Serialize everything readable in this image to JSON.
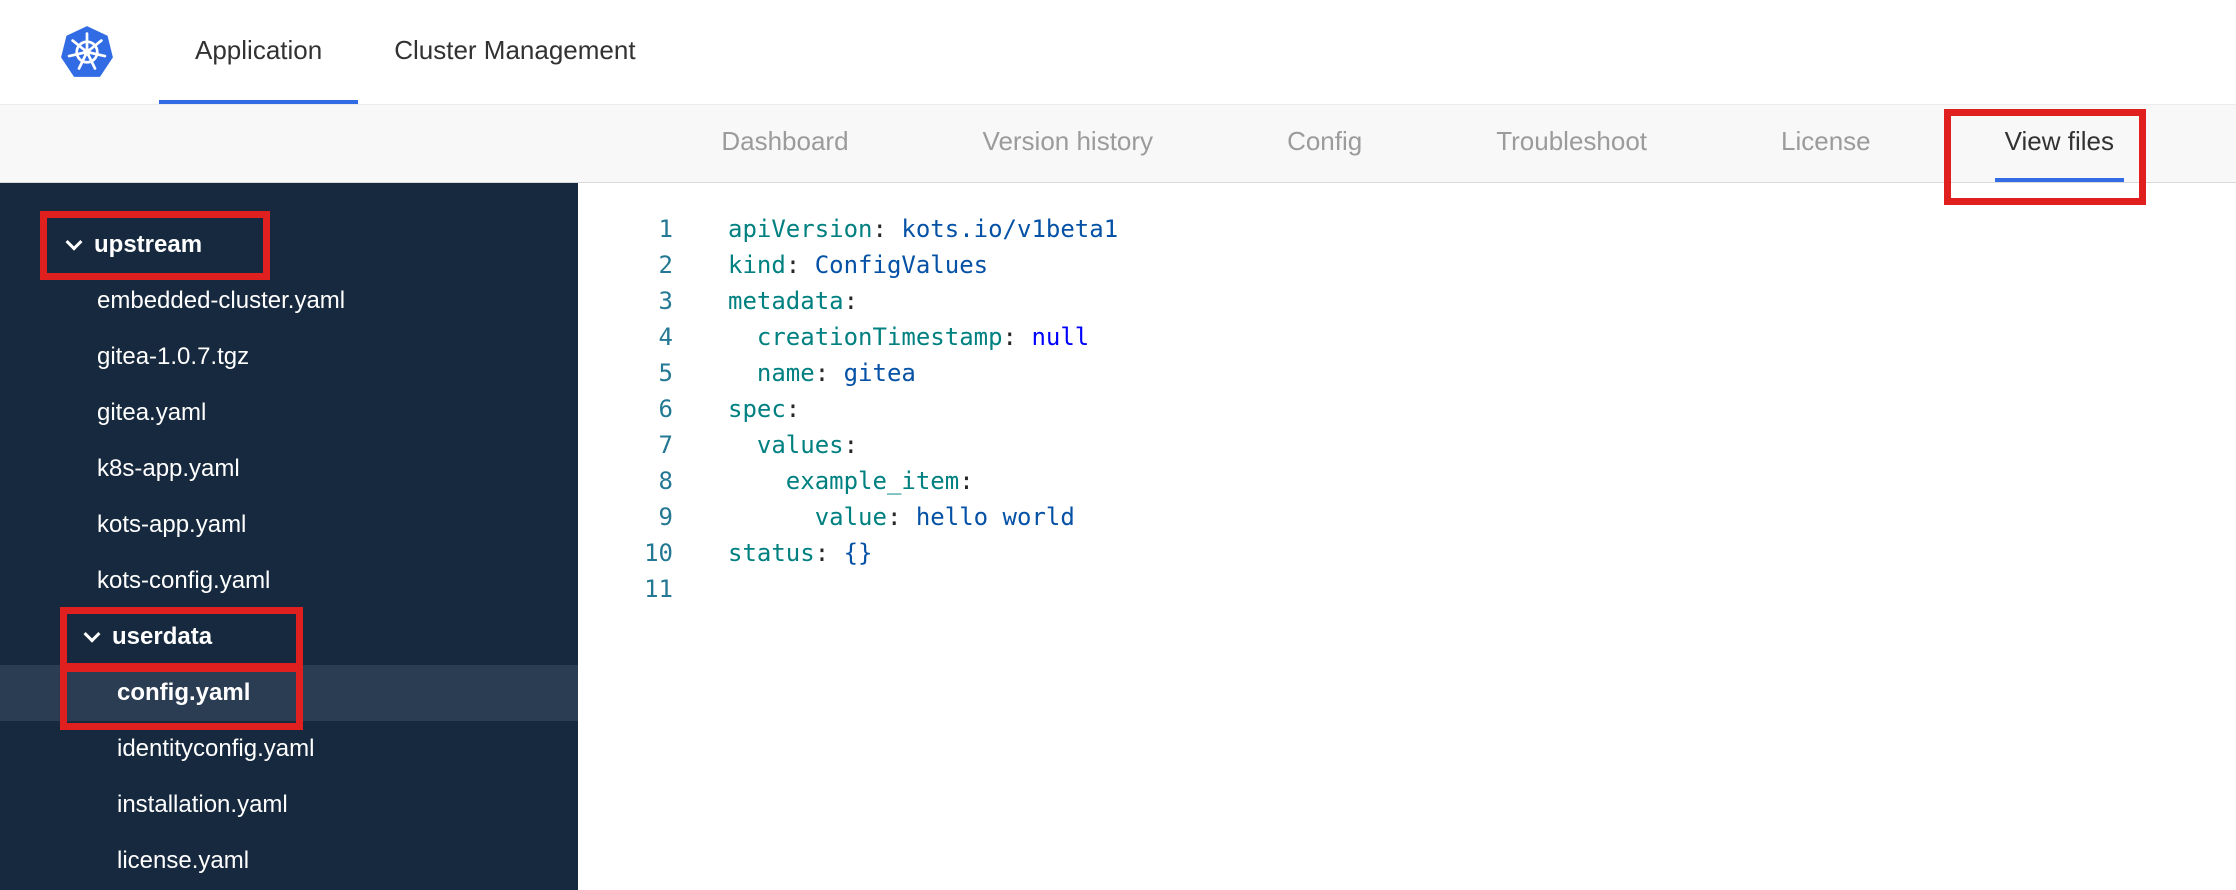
{
  "header": {
    "app_tabs": [
      {
        "label": "Application",
        "active": true
      },
      {
        "label": "Cluster Management",
        "active": false
      }
    ]
  },
  "logo": {
    "icon": "kubernetes-helm-wheel-icon"
  },
  "subnav": {
    "items": [
      {
        "label": "Dashboard",
        "active": false
      },
      {
        "label": "Version history",
        "active": false
      },
      {
        "label": "Config",
        "active": false
      },
      {
        "label": "Troubleshoot",
        "active": false
      },
      {
        "label": "License",
        "active": false
      },
      {
        "label": "View files",
        "active": true,
        "annotated": true
      }
    ]
  },
  "sidebar": {
    "items": [
      {
        "type": "folder",
        "label": "upstream",
        "depth": 0,
        "expanded": true,
        "annotated": true
      },
      {
        "type": "file",
        "label": "embedded-cluster.yaml",
        "depth": 1
      },
      {
        "type": "file",
        "label": "gitea-1.0.7.tgz",
        "depth": 1
      },
      {
        "type": "file",
        "label": "gitea.yaml",
        "depth": 1
      },
      {
        "type": "file",
        "label": "k8s-app.yaml",
        "depth": 1
      },
      {
        "type": "file",
        "label": "kots-app.yaml",
        "depth": 1
      },
      {
        "type": "file",
        "label": "kots-config.yaml",
        "depth": 1
      },
      {
        "type": "folder",
        "label": "userdata",
        "depth": 1,
        "expanded": true,
        "annotated": true
      },
      {
        "type": "file",
        "label": "config.yaml",
        "depth": 2,
        "selected": true,
        "annotated": true
      },
      {
        "type": "file",
        "label": "identityconfig.yaml",
        "depth": 2
      },
      {
        "type": "file",
        "label": "installation.yaml",
        "depth": 2
      },
      {
        "type": "file",
        "label": "license.yaml",
        "depth": 2
      }
    ]
  },
  "editor": {
    "language": "yaml",
    "lines": [
      [
        {
          "c": "key",
          "t": "apiVersion"
        },
        {
          "c": "plain",
          "t": ": "
        },
        {
          "c": "val",
          "t": "kots.io/v1beta1"
        }
      ],
      [
        {
          "c": "key",
          "t": "kind"
        },
        {
          "c": "plain",
          "t": ": "
        },
        {
          "c": "val",
          "t": "ConfigValues"
        }
      ],
      [
        {
          "c": "key",
          "t": "metadata"
        },
        {
          "c": "plain",
          "t": ":"
        }
      ],
      [
        {
          "c": "plain",
          "t": "  "
        },
        {
          "c": "key",
          "t": "creationTimestamp"
        },
        {
          "c": "plain",
          "t": ": "
        },
        {
          "c": "kw",
          "t": "null"
        }
      ],
      [
        {
          "c": "plain",
          "t": "  "
        },
        {
          "c": "key",
          "t": "name"
        },
        {
          "c": "plain",
          "t": ": "
        },
        {
          "c": "val",
          "t": "gitea"
        }
      ],
      [
        {
          "c": "key",
          "t": "spec"
        },
        {
          "c": "plain",
          "t": ":"
        }
      ],
      [
        {
          "c": "plain",
          "t": "  "
        },
        {
          "c": "key",
          "t": "values"
        },
        {
          "c": "plain",
          "t": ":"
        }
      ],
      [
        {
          "c": "plain",
          "t": "    "
        },
        {
          "c": "key",
          "t": "example_item"
        },
        {
          "c": "plain",
          "t": ":"
        }
      ],
      [
        {
          "c": "plain",
          "t": "      "
        },
        {
          "c": "key",
          "t": "value"
        },
        {
          "c": "plain",
          "t": ": "
        },
        {
          "c": "val",
          "t": "hello world"
        }
      ],
      [
        {
          "c": "key",
          "t": "status"
        },
        {
          "c": "plain",
          "t": ": "
        },
        {
          "c": "punct",
          "t": "{}"
        }
      ],
      []
    ]
  },
  "annotations": {
    "highlighted_elements": [
      "view-files-tab",
      "upstream-folder",
      "userdata-folder",
      "config-yaml-file"
    ]
  },
  "colors": {
    "accent_blue": "#326de6",
    "annotation_red": "#e01f1f",
    "sidebar_bg": "#17293e",
    "sidebar_selected": "#2b3d52",
    "tok_key": "#008080",
    "tok_val": "#0451a5",
    "tok_kw": "#0000ff",
    "tok_punct": "#0451a5",
    "line_number": "#237893",
    "logo_blue": "#326ce5"
  }
}
